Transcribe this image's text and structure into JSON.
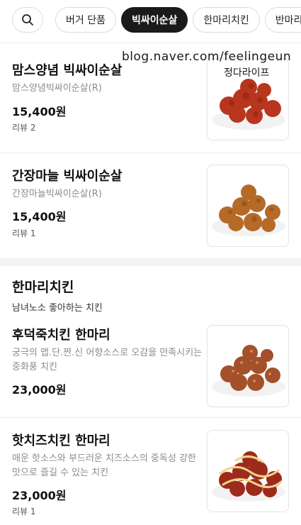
{
  "tabs": {
    "items": [
      "버거 단품",
      "빅싸이순살",
      "한마리치킨",
      "반마리치"
    ],
    "active": 1
  },
  "watermark": {
    "line1": "blog.naver.com/feelingeun",
    "line2": "정다라이프"
  },
  "items": [
    {
      "name": "맘스양념 빅싸이순살",
      "desc": "맘스양념빅싸이순살(R)",
      "price": "15,400원",
      "review": "리뷰 2",
      "image": "sauced-fried-chicken"
    },
    {
      "name": "간장마늘 빅싸이순살",
      "desc": "간장마늘빅싸이순살(R)",
      "price": "15,400원",
      "review": "리뷰 1",
      "image": "soy-garlic-chicken"
    },
    {
      "name": "후덕죽치킨 한마리",
      "desc": "궁극의 맵.단.짠.신 어향소스로 오감을 만족시키는 중화풍 치킨",
      "price": "23,000원",
      "review": "",
      "image": "chinese-style-chicken"
    },
    {
      "name": "핫치즈치킨 한마리",
      "desc": "매운 핫소스와 부드러운 치즈소스의 중독성 강한 맛으로 즐길 수 있는 치킨",
      "price": "23,000원",
      "review": "리뷰 1",
      "image": "hot-cheese-chicken"
    }
  ],
  "section": {
    "title": "한마리치킨",
    "subtitle": "남녀노소 좋아하는 치킨"
  },
  "icons": {
    "search": "search-icon"
  },
  "colors": {
    "active_chip": "#1a1a1a",
    "desc_text": "#8c8c8c",
    "sauce": "#b8361e",
    "fried": "#b56a28",
    "cheese": "#f0d58a"
  }
}
